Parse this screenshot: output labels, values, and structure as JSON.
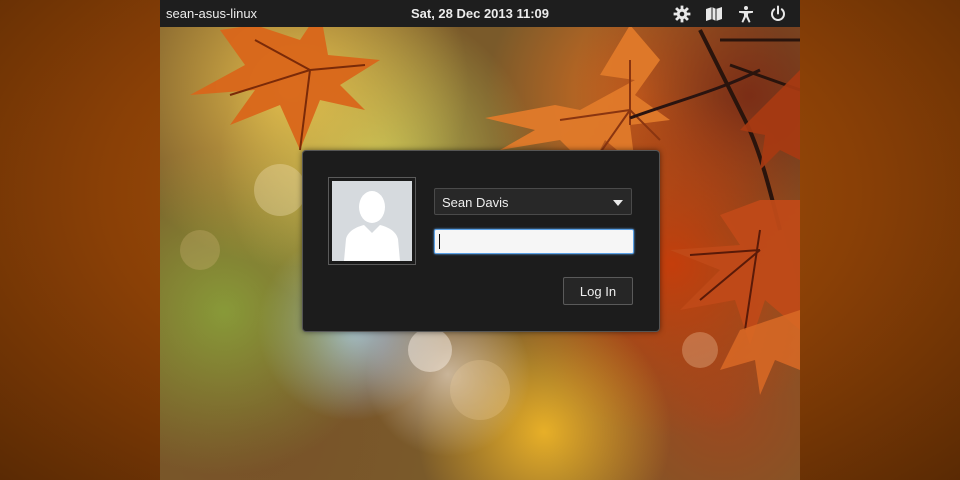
{
  "top_panel": {
    "hostname": "sean-asus-linux",
    "clock": "Sat, 28 Dec 2013 11:09",
    "tray_icons": [
      "gear-icon",
      "keyboard-layout-icon",
      "accessibility-icon",
      "power-icon"
    ]
  },
  "login": {
    "user_name": "Sean Davis",
    "password_value": "",
    "password_placeholder": "",
    "login_label": "Log In"
  },
  "colors": {
    "panel_bg": "#1e1e1e",
    "dialog_bg": "#1c1c1c",
    "focus_ring": "#5aa0e6"
  }
}
